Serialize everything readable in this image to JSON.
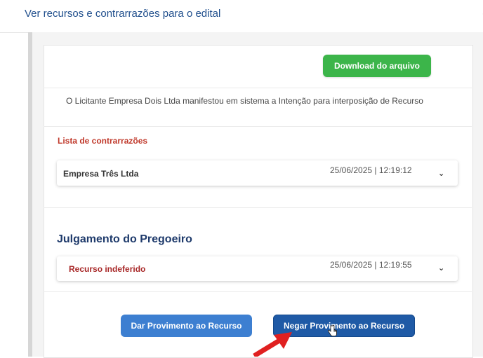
{
  "header": {
    "title": "Ver recursos e contrarrazões para o edital",
    "right_glyph": "("
  },
  "download": {
    "label": "Download do arquivo"
  },
  "info": {
    "text": "O Licitante Empresa Dois Ltda manifestou em sistema a Intenção para interposição de Recurso"
  },
  "contrarrazoes": {
    "label": "Lista de contrarrazões",
    "items": [
      {
        "name": "Empresa Três Ltda",
        "date": "25/06/2025 | 12:19:12"
      }
    ]
  },
  "julgamento": {
    "title": "Julgamento do Pregoeiro",
    "result": {
      "name": "Recurso indeferido",
      "date": "25/06/2025 | 12:19:55"
    }
  },
  "actions": {
    "dar_label": "Dar Provimento ao Recurso",
    "negar_label": "Negar Provimento ao Recurso"
  },
  "colors": {
    "download_green": "#3cb54a",
    "dar_blue": "#3d7fd1",
    "negar_blue": "#1f5aa6",
    "label_red": "#c0392b",
    "title_navy": "#1e3a6b",
    "arrow_red": "#e02020"
  },
  "icons": {
    "chevron": "chevron-down-icon",
    "cursor": "hand-pointer-icon",
    "annotation": "red-arrow-icon"
  }
}
